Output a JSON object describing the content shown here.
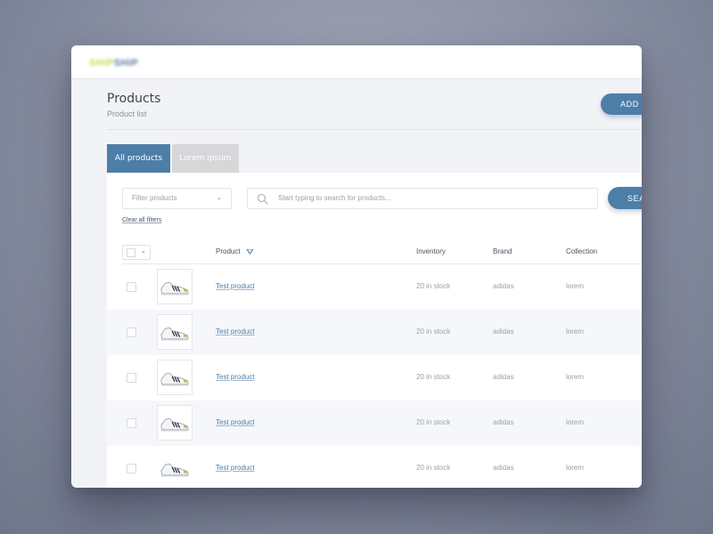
{
  "header": {
    "logo_part1": "SHIP",
    "logo_part2": "SHIP",
    "title": "Products",
    "subtitle": "Product list",
    "add_button_label": "ADD P"
  },
  "tabs": [
    {
      "label": "All products",
      "active": true
    },
    {
      "label": "Lorem ipsum",
      "active": false
    }
  ],
  "filters": {
    "filter_select_placeholder": "Filter products",
    "search_placeholder": "Start typing to search for products...",
    "search_button_label": "SEA",
    "clear_link": "Clear all filters"
  },
  "table": {
    "columns": [
      "Product",
      "Inventory",
      "Brand",
      "Collection"
    ],
    "rows": [
      {
        "product": "Test product",
        "inventory": "20 in stock",
        "brand": "adidas",
        "collection": "lorem"
      },
      {
        "product": "Test product",
        "inventory": "20 in stock",
        "brand": "adidas",
        "collection": "lorem"
      },
      {
        "product": "Test product",
        "inventory": "20 in stock",
        "brand": "adidas",
        "collection": "lorem"
      },
      {
        "product": "Test product",
        "inventory": "20 in stock",
        "brand": "adidas",
        "collection": "lorem"
      },
      {
        "product": "Test product",
        "inventory": "20 in stock",
        "brand": "adidas",
        "collection": "lorem"
      }
    ]
  },
  "colors": {
    "accent": "#4d7ea8",
    "inactive_tab": "#d7d7da"
  },
  "icons": {
    "search": "search-icon",
    "sort": "sort-down-icon",
    "chevron": "chevron-down-icon",
    "thumbnail": "sneaker-icon"
  }
}
